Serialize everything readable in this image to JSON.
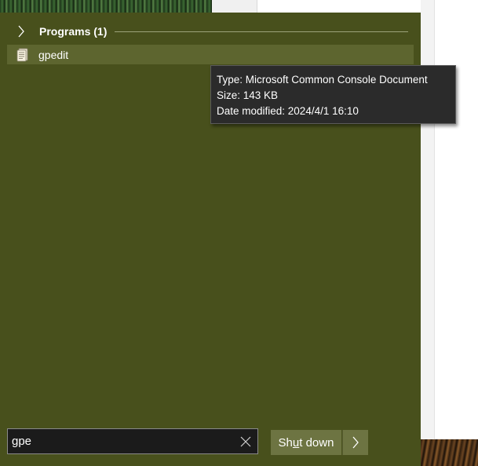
{
  "programs_group": {
    "title": "Programs (1)"
  },
  "result": {
    "label": "gpedit",
    "icon": "console-document-icon"
  },
  "tooltip": {
    "type": "Type: Microsoft Common Console Document",
    "size": "Size: 143 KB",
    "date_modified": "Date modified: 2024/4/1 16:10"
  },
  "search": {
    "value": "gpe"
  },
  "power": {
    "shutdown_pre": "Sh",
    "shutdown_accel": "u",
    "shutdown_post": "t down"
  },
  "colors": {
    "panel": "#48501c",
    "highlight": "#5d652f",
    "button": "#6d7442"
  }
}
